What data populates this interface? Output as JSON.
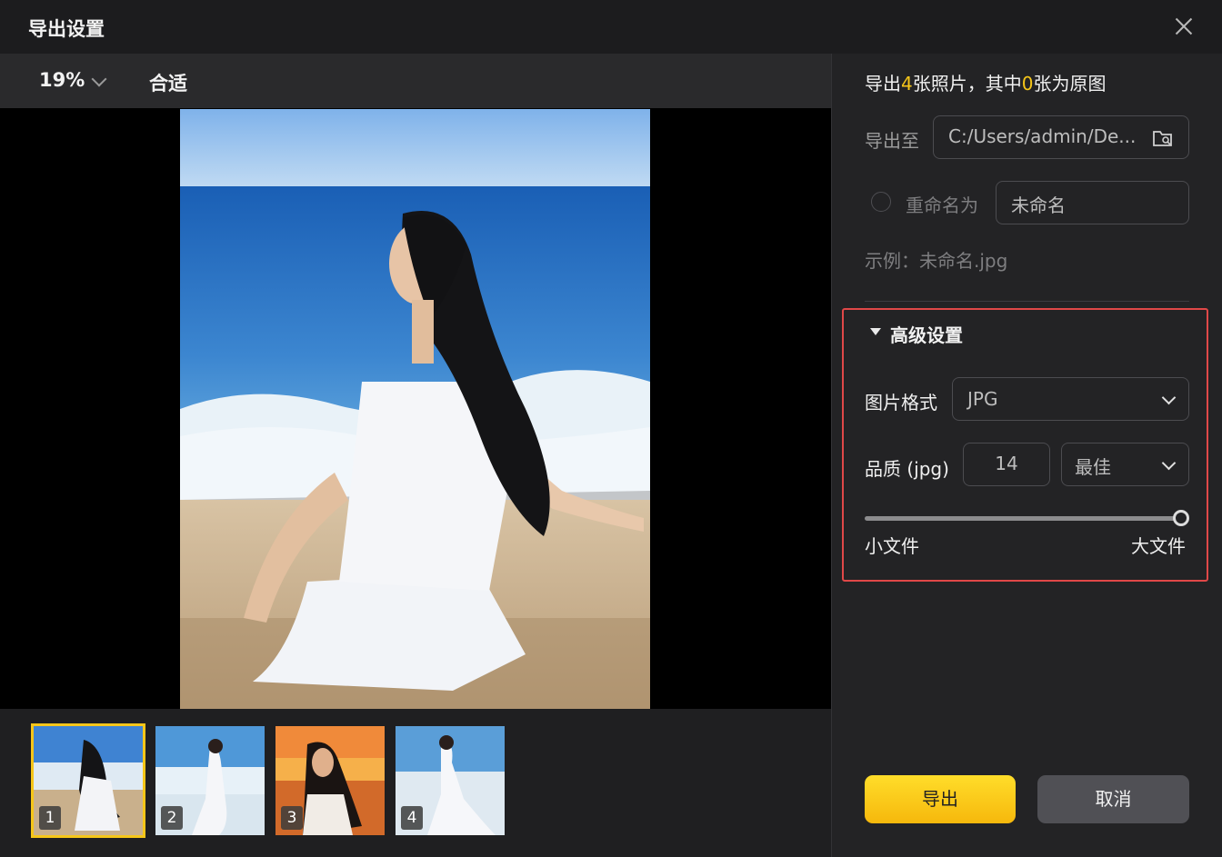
{
  "dialog": {
    "title": "导出设置"
  },
  "toolbar": {
    "zoom": "19%",
    "fit_label": "合适"
  },
  "thumbnails": [
    {
      "number": "1",
      "selected": true
    },
    {
      "number": "2",
      "selected": false
    },
    {
      "number": "3",
      "selected": false
    },
    {
      "number": "4",
      "selected": false
    }
  ],
  "summary": {
    "prefix": "导出",
    "count": "4",
    "middle": "张照片，其中",
    "original_count": "0",
    "suffix": "张为原图"
  },
  "export_to": {
    "label": "导出至",
    "path": "C:/Users/admin/De..."
  },
  "rename": {
    "label": "重命名为",
    "value": "未命名",
    "checked": false
  },
  "example": {
    "text": "示例：未命名.jpg"
  },
  "advanced": {
    "title": "高级设置",
    "format_label": "图片格式",
    "format_value": "JPG",
    "quality_label": "品质 (jpg)",
    "quality_value": "14",
    "quality_preset": "最佳",
    "slider_value": 1.0,
    "small_label": "小文件",
    "large_label": "大文件"
  },
  "buttons": {
    "export": "导出",
    "cancel": "取消"
  },
  "colors": {
    "accent": "#f6c619",
    "highlight_border": "#e04848"
  }
}
